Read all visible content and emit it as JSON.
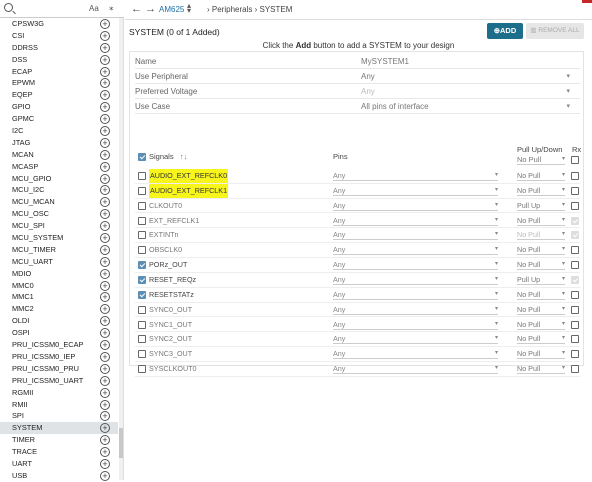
{
  "search": {
    "placeholder": "",
    "value": "",
    "case_label": "Aa",
    "options_icon": "filter-icon"
  },
  "peripherals": [
    {
      "name": "CPSW3G"
    },
    {
      "name": "CSI"
    },
    {
      "name": "DDRSS"
    },
    {
      "name": "DSS"
    },
    {
      "name": "ECAP"
    },
    {
      "name": "EPWM"
    },
    {
      "name": "EQEP"
    },
    {
      "name": "GPIO"
    },
    {
      "name": "GPMC"
    },
    {
      "name": "I2C"
    },
    {
      "name": "JTAG"
    },
    {
      "name": "MCAN"
    },
    {
      "name": "MCASP"
    },
    {
      "name": "MCU_GPIO"
    },
    {
      "name": "MCU_I2C"
    },
    {
      "name": "MCU_MCAN"
    },
    {
      "name": "MCU_OSC"
    },
    {
      "name": "MCU_SPI"
    },
    {
      "name": "MCU_SYSTEM"
    },
    {
      "name": "MCU_TIMER"
    },
    {
      "name": "MCU_UART"
    },
    {
      "name": "MDIO"
    },
    {
      "name": "MMC0"
    },
    {
      "name": "MMC1"
    },
    {
      "name": "MMC2"
    },
    {
      "name": "OLDI"
    },
    {
      "name": "OSPI"
    },
    {
      "name": "PRU_ICSSM0_ECAP"
    },
    {
      "name": "PRU_ICSSM0_IEP"
    },
    {
      "name": "PRU_ICSSM0_PRU"
    },
    {
      "name": "PRU_ICSSM0_UART"
    },
    {
      "name": "RGMII"
    },
    {
      "name": "RMII"
    },
    {
      "name": "SPI"
    },
    {
      "name": "SYSTEM"
    },
    {
      "name": "TIMER"
    },
    {
      "name": "TRACE"
    },
    {
      "name": "UART"
    },
    {
      "name": "USB"
    }
  ],
  "selected_peripheral": "SYSTEM",
  "topbar": {
    "back": "←",
    "forward": "→",
    "device": "AM625",
    "breadcrumb": "›  Peripherals  ›  SYSTEM"
  },
  "panel": {
    "title": "SYSTEM (0 of 1 Added)",
    "add_label": "ADD",
    "remove_label": "REMOVE ALL",
    "hint_pre": "Click the ",
    "hint_bold": "Add",
    "hint_post": " button to add a SYSTEM to your design"
  },
  "fields": [
    {
      "label": "Name",
      "value": "MySYSTEM1",
      "dropdown": false,
      "disabled": false
    },
    {
      "label": "Use Peripheral",
      "value": "Any",
      "dropdown": true,
      "disabled": false
    },
    {
      "label": "Preferred Voltage",
      "value": "Any",
      "dropdown": true,
      "disabled": true
    },
    {
      "label": "Use Case",
      "value": "All pins of interface",
      "dropdown": true,
      "disabled": false
    }
  ],
  "signals_header": {
    "signals": "Signals",
    "sort": "↑↓",
    "pins": "Pins",
    "pull": "Pull Up/Down",
    "rx": "Rx",
    "pull_all": "No Pull"
  },
  "signals": [
    {
      "name": "AUDIO_EXT_REFCLK0",
      "checked": false,
      "highlight": true,
      "pin": "Any",
      "pull": "No Pull",
      "pull_disabled": false,
      "rx": "off"
    },
    {
      "name": "AUDIO_EXT_REFCLK1",
      "checked": false,
      "highlight": true,
      "pin": "Any",
      "pull": "No Pull",
      "pull_disabled": false,
      "rx": "off"
    },
    {
      "name": "CLKOUT0",
      "checked": false,
      "highlight": false,
      "pin": "Any",
      "pull": "Pull Up",
      "pull_disabled": false,
      "rx": "off"
    },
    {
      "name": "EXT_REFCLK1",
      "checked": false,
      "highlight": false,
      "pin": "Any",
      "pull": "No Pull",
      "pull_disabled": false,
      "rx": "disabled-on"
    },
    {
      "name": "EXTINTn",
      "checked": false,
      "highlight": false,
      "pin": "Any",
      "pull": "No Pull",
      "pull_disabled": true,
      "rx": "disabled-on"
    },
    {
      "name": "OBSCLK0",
      "checked": false,
      "highlight": false,
      "pin": "Any",
      "pull": "No Pull",
      "pull_disabled": false,
      "rx": "off"
    },
    {
      "name": "PORz_OUT",
      "checked": true,
      "highlight": false,
      "pin": "Any",
      "pull": "No Pull",
      "pull_disabled": false,
      "rx": "off"
    },
    {
      "name": "RESET_REQz",
      "checked": true,
      "highlight": false,
      "pin": "Any",
      "pull": "Pull Up",
      "pull_disabled": false,
      "rx": "disabled-on"
    },
    {
      "name": "RESETSTATz",
      "checked": true,
      "highlight": false,
      "pin": "Any",
      "pull": "No Pull",
      "pull_disabled": false,
      "rx": "off"
    },
    {
      "name": "SYNC0_OUT",
      "checked": false,
      "highlight": false,
      "pin": "Any",
      "pull": "No Pull",
      "pull_disabled": false,
      "rx": "off"
    },
    {
      "name": "SYNC1_OUT",
      "checked": false,
      "highlight": false,
      "pin": "Any",
      "pull": "No Pull",
      "pull_disabled": false,
      "rx": "off"
    },
    {
      "name": "SYNC2_OUT",
      "checked": false,
      "highlight": false,
      "pin": "Any",
      "pull": "No Pull",
      "pull_disabled": false,
      "rx": "off"
    },
    {
      "name": "SYNC3_OUT",
      "checked": false,
      "highlight": false,
      "pin": "Any",
      "pull": "No Pull",
      "pull_disabled": false,
      "rx": "off"
    },
    {
      "name": "SYSCLKOUT0",
      "checked": false,
      "highlight": false,
      "pin": "Any",
      "pull": "No Pull",
      "pull_disabled": false,
      "rx": "off"
    }
  ],
  "colors": {
    "accent": "#1d6e8a",
    "highlight": "#f7f51b",
    "checkbox": "#5b8fb6",
    "device_link": "#1b6fa8"
  }
}
